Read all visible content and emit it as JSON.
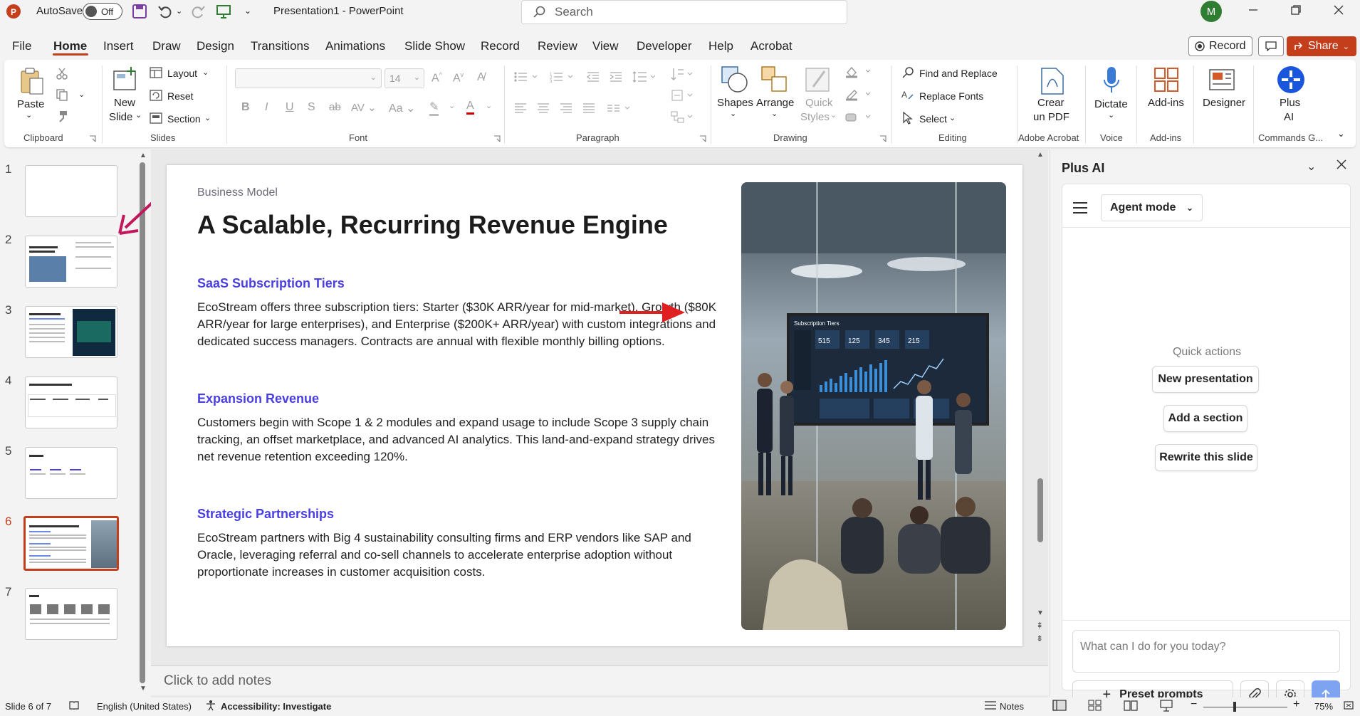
{
  "titlebar": {
    "autosave_label": "AutoSave",
    "autosave_state": "Off",
    "doc_title": "Presentation1  -  PowerPoint",
    "search_placeholder": "Search",
    "avatar_initial": "M"
  },
  "menu": {
    "tabs": [
      "File",
      "Home",
      "Insert",
      "Draw",
      "Design",
      "Transitions",
      "Animations",
      "Slide Show",
      "Record",
      "Review",
      "View",
      "Developer",
      "Help",
      "Acrobat"
    ],
    "active_tab": "Home",
    "record_button": "Record",
    "share_button": "Share"
  },
  "ribbon": {
    "clipboard": {
      "paste": "Paste",
      "group": "Clipboard"
    },
    "slides": {
      "new_slide_1": "New",
      "new_slide_2": "Slide",
      "layout": "Layout",
      "reset": "Reset",
      "section": "Section",
      "group": "Slides"
    },
    "font": {
      "font_size": "14",
      "group": "Font"
    },
    "paragraph": {
      "group": "Paragraph"
    },
    "drawing": {
      "shapes": "Shapes",
      "arrange": "Arrange",
      "quick_1": "Quick",
      "quick_2": "Styles",
      "group": "Drawing"
    },
    "editing": {
      "find_replace": "Find and Replace",
      "replace_fonts": "Replace Fonts",
      "select": "Select",
      "group": "Editing"
    },
    "acrobat": {
      "crear_1": "Crear",
      "crear_2": "un PDF",
      "group": "Adobe Acrobat"
    },
    "voice": {
      "dictate": "Dictate",
      "group": "Voice"
    },
    "addins": {
      "addins": "Add-ins",
      "group": "Add-ins"
    },
    "designer": {
      "designer": "Designer"
    },
    "plusai": {
      "label_1": "Plus",
      "label_2": "AI",
      "group": "Commands G..."
    }
  },
  "thumbnails": {
    "numbers": [
      "1",
      "2",
      "3",
      "4",
      "5",
      "6",
      "7"
    ],
    "active_index": 6
  },
  "slide": {
    "eyebrow": "Business Model",
    "title": "A Scalable, Recurring Revenue Engine",
    "sections": [
      {
        "heading": "SaaS Subscription Tiers",
        "body": "EcoStream offers three subscription tiers: Starter ($30K ARR/year for mid-market), Growth ($80K ARR/year for large enterprises), and Enterprise ($200K+ ARR/year) with custom integrations and dedicated success managers. Contracts are annual with flexible monthly billing options."
      },
      {
        "heading": "Expansion Revenue",
        "body": "Customers begin with Scope 1 & 2 modules and expand usage to include Scope 3 supply chain tracking, an offset marketplace, and advanced AI analytics. This land-and-expand strategy drives net revenue retention exceeding 120%."
      },
      {
        "heading": "Strategic Partnerships",
        "body": "EcoStream partners with Big 4 sustainability consulting firms and ERP vendors like SAP and Oracle, leveraging referral and co-sell channels to accelerate enterprise adoption without proportionate increases in customer acquisition costs."
      }
    ],
    "image_screen_title": "Subscription Tiers",
    "image_kpis": [
      "515",
      "125",
      "345",
      "215"
    ]
  },
  "notes": {
    "placeholder": "Click to add notes"
  },
  "plus_ai": {
    "title": "Plus AI",
    "mode": "Agent mode",
    "quick_actions_label": "Quick actions",
    "quick_actions": [
      "New presentation",
      "Add a section",
      "Rewrite this slide"
    ],
    "input_placeholder": "What can I do for you today?",
    "preset_prompts": "Preset prompts"
  },
  "statusbar": {
    "slide_info": "Slide 6 of 7",
    "language": "English (United States)",
    "accessibility": "Accessibility: Investigate",
    "notes": "Notes",
    "zoom": "75%"
  },
  "colors": {
    "accent": "#c43e1c",
    "heading_blue": "#4a3fe0",
    "annotation_red": "#e02020",
    "annotation_magenta": "#c2185b"
  }
}
